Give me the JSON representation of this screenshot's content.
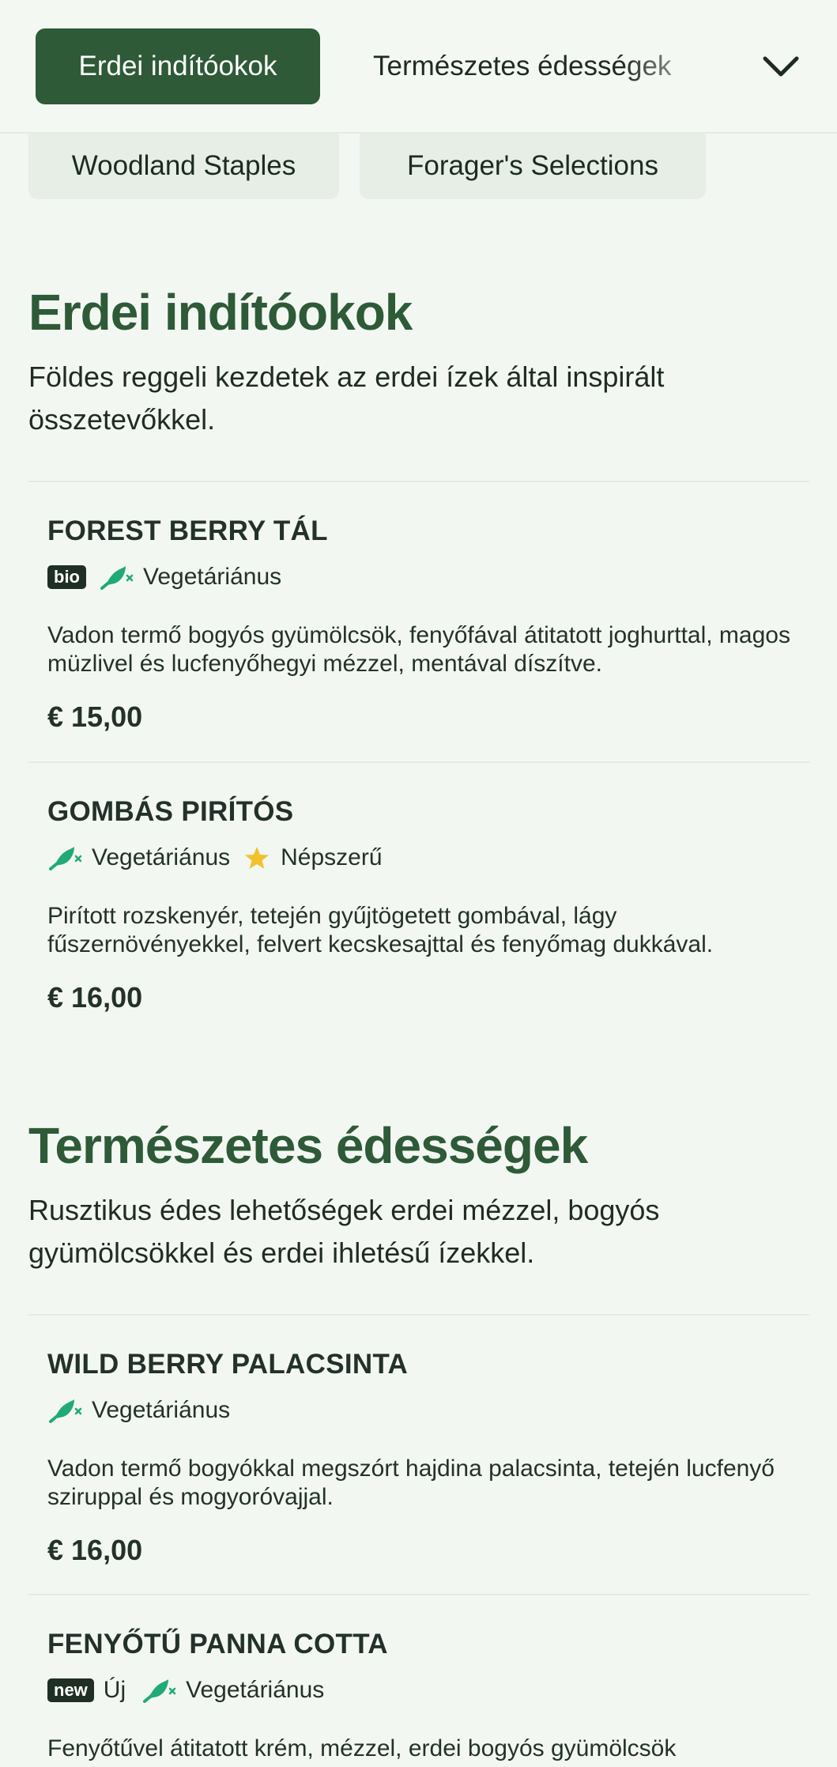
{
  "nav": {
    "active_tab": "Erdei indítóokok",
    "next_tab": "Természetes édességek",
    "chips": [
      "Woodland Staples",
      "Forager's Selections"
    ]
  },
  "sections": [
    {
      "title": "Erdei indítóokok",
      "description": "Földes reggeli kezdetek az erdei ízek által inspirált összetevőkkel.",
      "items": [
        {
          "name": "FOREST BERRY TÁL",
          "badge": "bio",
          "tag1": "Vegetáriánus",
          "description": "Vadon termő bogyós gyümölcsök, fenyőfával átitatott joghurttal, magos müzlivel és lucfenyőhegyi mézzel, mentával díszítve.",
          "price": "€ 15,00"
        },
        {
          "name": "GOMBÁS PIRÍTÓS",
          "tag1": "Vegetáriánus",
          "tag2": "Népszerű",
          "description": "Pirított rozskenyér, tetején gyűjtögetett gombával, lágy fűszernövényekkel, felvert kecskesajttal és fenyőmag dukkával.",
          "price": "€ 16,00"
        }
      ]
    },
    {
      "title": "Természetes édességek",
      "description": "Rusztikus édes lehetőségek erdei mézzel, bogyós gyümölcsökkel és erdei ihletésű ízekkel.",
      "items": [
        {
          "name": "WILD BERRY PALACSINTA",
          "tag1": "Vegetáriánus",
          "description": "Vadon termő bogyókkal megszórt hajdina palacsinta, tetején lucfenyő sziruppal és mogyoróvajjal.",
          "price": "€ 16,00"
        },
        {
          "name": "FENYŐTŰ PANNA COTTA",
          "badge": "new",
          "badge_text": "Új",
          "tag1": "Vegetáriánus",
          "description": "Fenyőtűvel átitatott krém, mézzel, erdei bogyós gyümölcsök"
        }
      ]
    }
  ],
  "colors": {
    "accent": "#2e5a37",
    "background": "#f3f7f2",
    "veg_icon": "#1faa78",
    "star": "#f2c12e"
  },
  "icons": [
    "chevron-down-icon",
    "vegetarian-icon",
    "star-icon"
  ]
}
